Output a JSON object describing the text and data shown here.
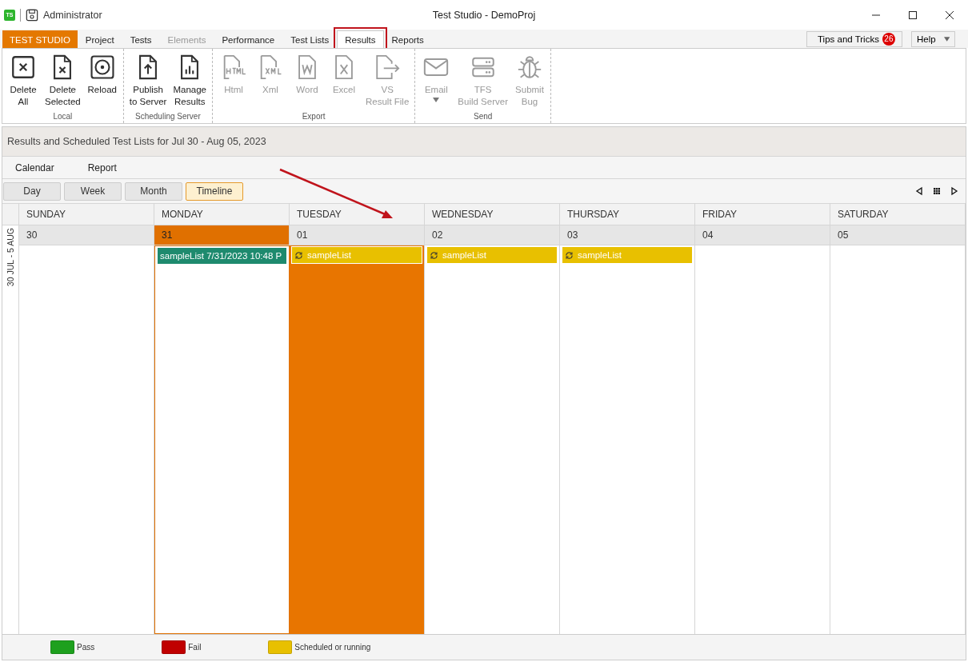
{
  "window": {
    "logo_text": "TS",
    "user": "Administrator",
    "title": "Test Studio - DemoProj"
  },
  "tabs": [
    {
      "label": "TEST STUDIO",
      "kind": "app",
      "selected": false,
      "disabled": false,
      "annotated": false
    },
    {
      "label": "Project",
      "kind": "tab",
      "selected": false,
      "disabled": false,
      "annotated": false
    },
    {
      "label": "Tests",
      "kind": "tab",
      "selected": false,
      "disabled": false,
      "annotated": false
    },
    {
      "label": "Elements",
      "kind": "tab",
      "selected": false,
      "disabled": true,
      "annotated": false
    },
    {
      "label": "Performance",
      "kind": "tab",
      "selected": false,
      "disabled": false,
      "annotated": false
    },
    {
      "label": "Test Lists",
      "kind": "tab",
      "selected": false,
      "disabled": false,
      "annotated": false
    },
    {
      "label": "Results",
      "kind": "tab",
      "selected": true,
      "disabled": false,
      "annotated": true
    },
    {
      "label": "Reports",
      "kind": "tab",
      "selected": false,
      "disabled": false,
      "annotated": false
    }
  ],
  "tips": {
    "label": "Tips and Tricks",
    "count": "26"
  },
  "help": {
    "label": "Help"
  },
  "ribbon": [
    {
      "name": "Local",
      "buttons": [
        {
          "kind": "deleteall",
          "label": "Delete\nAll",
          "disabled": false
        },
        {
          "kind": "delete",
          "label": "Delete\nSelected",
          "disabled": false
        },
        {
          "kind": "reload",
          "label": "Reload",
          "disabled": false
        }
      ]
    },
    {
      "name": "Scheduling Server",
      "buttons": [
        {
          "kind": "publish",
          "label": "Publish\nto Server",
          "disabled": false
        },
        {
          "kind": "manage",
          "label": "Manage\nResults",
          "disabled": false
        }
      ]
    },
    {
      "name": "Export",
      "buttons": [
        {
          "kind": "html",
          "label": "Html",
          "disabled": true
        },
        {
          "kind": "xml",
          "label": "Xml",
          "disabled": true
        },
        {
          "kind": "word",
          "label": "Word",
          "disabled": true
        },
        {
          "kind": "excel",
          "label": "Excel",
          "disabled": true
        },
        {
          "kind": "export",
          "label": "VS\nResult File",
          "disabled": true
        }
      ]
    },
    {
      "name": "Send",
      "buttons": [
        {
          "kind": "email",
          "label": "Email",
          "disabled": true,
          "dropdown": true
        },
        {
          "kind": "server",
          "label": "TFS\nBuild Server",
          "disabled": true
        },
        {
          "kind": "bug",
          "label": "Submit\nBug",
          "disabled": true
        }
      ]
    }
  ],
  "panel_title": "Results and Scheduled Test Lists for Jul 30 - Aug 05, 2023",
  "subtabs": [
    {
      "label": "Calendar"
    },
    {
      "label": "Report"
    }
  ],
  "views": [
    {
      "label": "Day",
      "selected": false
    },
    {
      "label": "Week",
      "selected": false
    },
    {
      "label": "Month",
      "selected": false
    },
    {
      "label": "Timeline",
      "selected": true
    }
  ],
  "week_label": "30 JUL - 5 AUG",
  "days": [
    {
      "name": "SUNDAY",
      "date": "30",
      "today": false,
      "selected": false
    },
    {
      "name": "MONDAY",
      "date": "31",
      "today": true,
      "selected": false,
      "events": [
        {
          "kind": "result",
          "label": "sampleList 7/31/2023 10:48 P",
          "color": "#1e8a6e"
        }
      ]
    },
    {
      "name": "TUESDAY",
      "date": "01",
      "today": false,
      "selected": true,
      "events": [
        {
          "kind": "scheduled",
          "label": "sampleList",
          "color": "#e8c000"
        }
      ]
    },
    {
      "name": "WEDNESDAY",
      "date": "02",
      "today": false,
      "selected": false,
      "events": [
        {
          "kind": "scheduled",
          "label": "sampleList",
          "color": "#e8c000"
        }
      ]
    },
    {
      "name": "THURSDAY",
      "date": "03",
      "today": false,
      "selected": false,
      "events": [
        {
          "kind": "scheduled",
          "label": "sampleList",
          "color": "#e8c000"
        }
      ]
    },
    {
      "name": "FRIDAY",
      "date": "04",
      "today": false,
      "selected": false
    },
    {
      "name": "SATURDAY",
      "date": "05",
      "today": false,
      "selected": false
    }
  ],
  "legend": [
    {
      "label": "Pass",
      "color": "#1ea01e"
    },
    {
      "label": "Fail",
      "color": "#c00000"
    },
    {
      "label": "Scheduled or running",
      "color": "#e8c000"
    }
  ],
  "annotations": [
    {
      "kind": "arrow"
    }
  ]
}
